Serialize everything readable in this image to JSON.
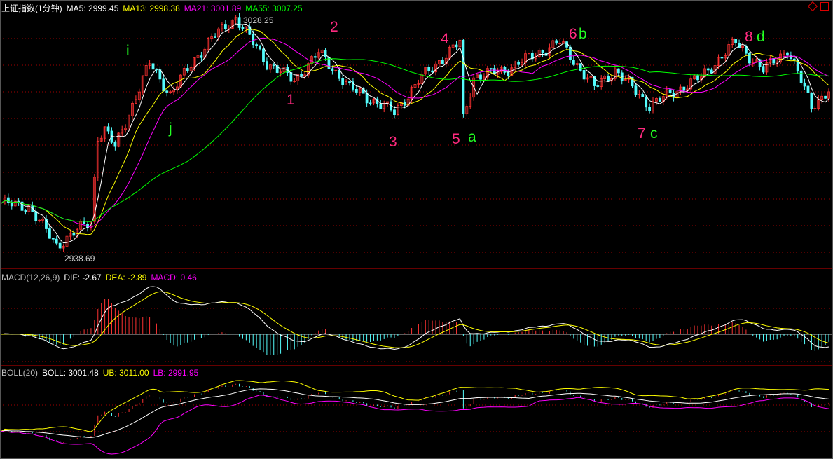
{
  "header": {
    "title": "上证指数(1分钟)",
    "ma5": "MA5: 2999.45",
    "ma13": "MA13: 2998.38",
    "ma21": "MA21: 3001.89",
    "ma55": "MA55: 3007.25"
  },
  "macd_header": {
    "name": "MACD(12,26,9)",
    "dif": "DIF: -2.67",
    "dea": "DEA: -2.89",
    "macd": "MACD: 0.46"
  },
  "boll_header": {
    "name": "BOLL(20)",
    "boll": "BOLL: 3001.48",
    "ub": "UB: 3011.00",
    "lb": "LB: 2991.95"
  },
  "price_labels": {
    "high": "3028.25",
    "low": "2938.69"
  },
  "annotations": [
    "i",
    "j",
    "1",
    "2",
    "3",
    "4",
    "5",
    "a",
    "6",
    "b",
    "7",
    "c",
    "8",
    "d"
  ],
  "toolbar_icons": [
    "diamond-icon",
    "split-panel-icon"
  ],
  "colors": {
    "up": "#ff3232",
    "down": "#54fcfc",
    "ma5": "#ffffff",
    "ma13": "#ffff00",
    "ma21": "#ff00ff",
    "ma55": "#00ff00",
    "grid": "#a00000"
  },
  "chart_data": {
    "type": "candlestick",
    "title": "上证指数(1分钟)",
    "minutes": 240,
    "price_range": [
      2938.69,
      3028.25
    ],
    "close_anchors": [
      [
        0,
        2958.9
      ],
      [
        8,
        2957.6
      ],
      [
        16,
        2943.3
      ],
      [
        19,
        2946
      ],
      [
        26,
        2952.4
      ],
      [
        28,
        2983.5
      ],
      [
        30,
        2986
      ],
      [
        33,
        2979.6
      ],
      [
        43,
        3010.7
      ],
      [
        49,
        2999
      ],
      [
        56,
        3012
      ],
      [
        61,
        3019.7
      ],
      [
        68,
        3027.5
      ],
      [
        77,
        3010.7
      ],
      [
        85,
        3004.2
      ],
      [
        92,
        3014.6
      ],
      [
        101,
        3001.6
      ],
      [
        114,
        2992.5
      ],
      [
        122,
        3005.5
      ],
      [
        133,
        3018.4
      ],
      [
        134,
        2990
      ],
      [
        137,
        3005.5
      ],
      [
        146,
        3008
      ],
      [
        156,
        3014.6
      ],
      [
        162,
        3018.4
      ],
      [
        172,
        3001.6
      ],
      [
        178,
        3008
      ],
      [
        188,
        2995
      ],
      [
        203,
        3005.5
      ],
      [
        213,
        3018.4
      ],
      [
        221,
        3008
      ],
      [
        228,
        3015.8
      ],
      [
        235,
        2995
      ],
      [
        240,
        3000.3
      ]
    ],
    "moving_averages": [
      5,
      13,
      21,
      55
    ],
    "macd_params": [
      12,
      26,
      9
    ],
    "boll_period": 20
  }
}
